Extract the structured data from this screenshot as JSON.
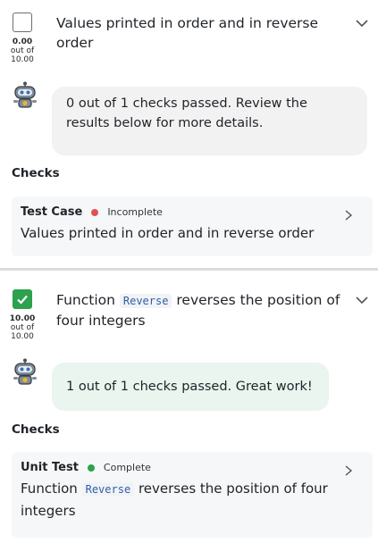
{
  "colors": {
    "complete_green": "#2da14d",
    "incomplete_red": "#e05252",
    "bubble_grey": "#f2f2f2",
    "bubble_green": "#e9f5ee"
  },
  "items": [
    {
      "checked": false,
      "score": "0.00",
      "out_of": "out of",
      "max": "10.00",
      "title": "Values printed in order and in reverse order",
      "feedback": "0 out of 1 checks passed. Review the results below for more details.",
      "checks_label": "Checks",
      "check": {
        "type": "Test Case",
        "status": "Incomplete",
        "description": "Values printed in order and in reverse order"
      }
    },
    {
      "checked": true,
      "score": "10.00",
      "out_of": "out of",
      "max": "10.00",
      "title_pre": "Function",
      "title_code": "Reverse",
      "title_post": "reverses the position of four integers",
      "feedback": "1 out of 1 checks passed. Great work!",
      "checks_label": "Checks",
      "check": {
        "type": "Unit Test",
        "status": "Complete",
        "desc_pre": "Function",
        "desc_code": "Reverse",
        "desc_post": "reverses the position of four integers"
      }
    }
  ],
  "icons": {
    "expand": "chevron-down-icon",
    "open": "chevron-right-icon",
    "avatar": "robot-icon",
    "checkmark": "checkmark-icon"
  }
}
